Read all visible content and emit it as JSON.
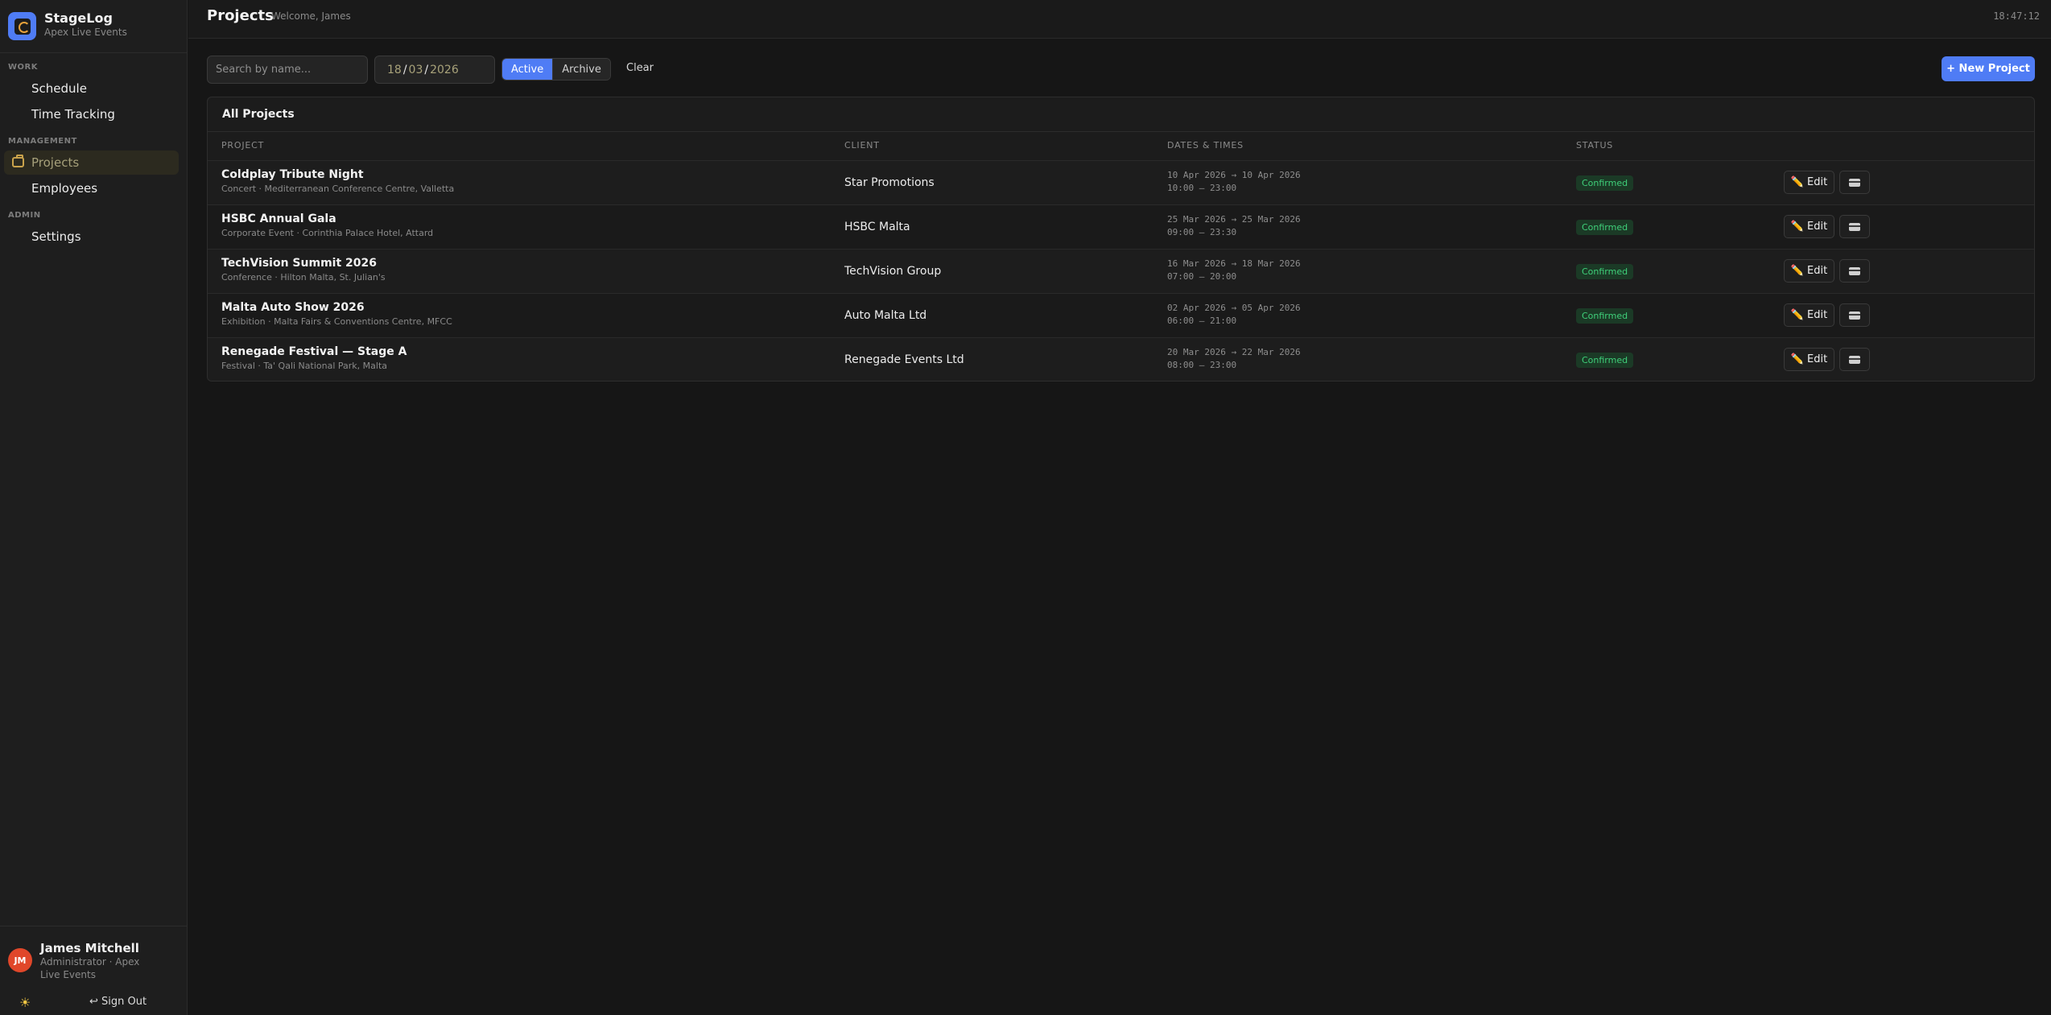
{
  "app": {
    "name": "StageLog",
    "org": "Apex Live Events"
  },
  "sidebar": {
    "sections": [
      {
        "label": "WORK",
        "items": [
          {
            "label": "Schedule"
          },
          {
            "label": "Time Tracking"
          }
        ]
      },
      {
        "label": "MANAGEMENT",
        "items": [
          {
            "label": "Projects",
            "active": true
          },
          {
            "label": "Employees"
          }
        ]
      },
      {
        "label": "ADMIN",
        "items": [
          {
            "label": "Settings"
          }
        ]
      }
    ],
    "user": {
      "initials": "JM",
      "name": "James Mitchell",
      "role": "Administrator · Apex Live Events"
    },
    "theme_icon": "☀",
    "sign_out": "↩ Sign Out"
  },
  "topbar": {
    "title": "Projects",
    "welcome": "Welcome, James",
    "clock": "18:47:12"
  },
  "filters": {
    "search_placeholder": "Search by name...",
    "date": {
      "day": "18",
      "month": "03",
      "year": "2026"
    },
    "tabs": [
      "Active",
      "Archive"
    ],
    "active_tab": "Active",
    "clear": "Clear",
    "new_project": "+ New Project"
  },
  "table": {
    "title": "All Projects",
    "columns": [
      "PROJECT",
      "CLIENT",
      "DATES & TIMES",
      "STATUS"
    ],
    "edit_label": "Edit",
    "edit_icon": "✏️",
    "rows": [
      {
        "name": "Coldplay Tribute Night",
        "sub": "Concert · Mediterranean Conference Centre, Valletta",
        "client": "Star Promotions",
        "dates": "10 Apr 2026 → 10 Apr 2026",
        "times": "10:00 – 23:00",
        "status": "Confirmed"
      },
      {
        "name": "HSBC Annual Gala",
        "sub": "Corporate Event · Corinthia Palace Hotel, Attard",
        "client": "HSBC Malta",
        "dates": "25 Mar 2026 → 25 Mar 2026",
        "times": "09:00 – 23:30",
        "status": "Confirmed"
      },
      {
        "name": "TechVision Summit 2026",
        "sub": "Conference · Hilton Malta, St. Julian's",
        "client": "TechVision Group",
        "dates": "16 Mar 2026 → 18 Mar 2026",
        "times": "07:00 – 20:00",
        "status": "Confirmed"
      },
      {
        "name": "Malta Auto Show 2026",
        "sub": "Exhibition · Malta Fairs & Conventions Centre, MFCC",
        "client": "Auto Malta Ltd",
        "dates": "02 Apr 2026 → 05 Apr 2026",
        "times": "06:00 – 21:00",
        "status": "Confirmed"
      },
      {
        "name": "Renegade Festival — Stage A",
        "sub": "Festival · Ta' Qali National Park, Malta",
        "client": "Renegade Events Ltd",
        "dates": "20 Mar 2026 → 22 Mar 2026",
        "times": "08:00 – 23:00",
        "status": "Confirmed"
      }
    ]
  }
}
